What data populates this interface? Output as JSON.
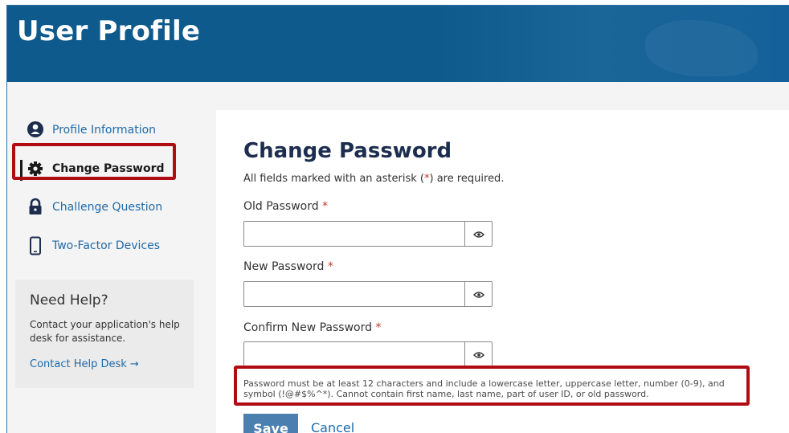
{
  "header": {
    "title": "User Profile"
  },
  "sidebar": {
    "items": [
      {
        "label": "Profile Information",
        "icon": "user-circle-icon"
      },
      {
        "label": "Change Password",
        "icon": "gear-icon",
        "active": true
      },
      {
        "label": "Challenge Question",
        "icon": "lock-icon"
      },
      {
        "label": "Two-Factor Devices",
        "icon": "mobile-phone-icon"
      }
    ],
    "help": {
      "title": "Need Help?",
      "text": "Contact your application's help desk for assistance.",
      "link": "Contact Help Desk →"
    }
  },
  "main": {
    "title": "Change Password",
    "required_note_pre": "All fields marked with an asterisk (",
    "required_note_star": "*",
    "required_note_post": ") are required.",
    "fields": [
      {
        "label": "Old Password",
        "required_marker": "*",
        "value": ""
      },
      {
        "label": "New Password",
        "required_marker": "*",
        "value": ""
      },
      {
        "label": "Confirm New Password",
        "required_marker": "*",
        "value": ""
      }
    ],
    "password_rules": "Password must be at least 12 characters and include a lowercase letter, uppercase letter, number (0-9), and symbol (!@#$%^*). Cannot contain first name, last name, part of user ID, or old password.",
    "save_label": "Save",
    "cancel_label": "Cancel"
  },
  "colors": {
    "banner": "#0f5a8c",
    "highlight": "#b00c14",
    "link": "#1f6aa8",
    "title": "#1c2d4f",
    "save_button": "#4a7fb0"
  }
}
